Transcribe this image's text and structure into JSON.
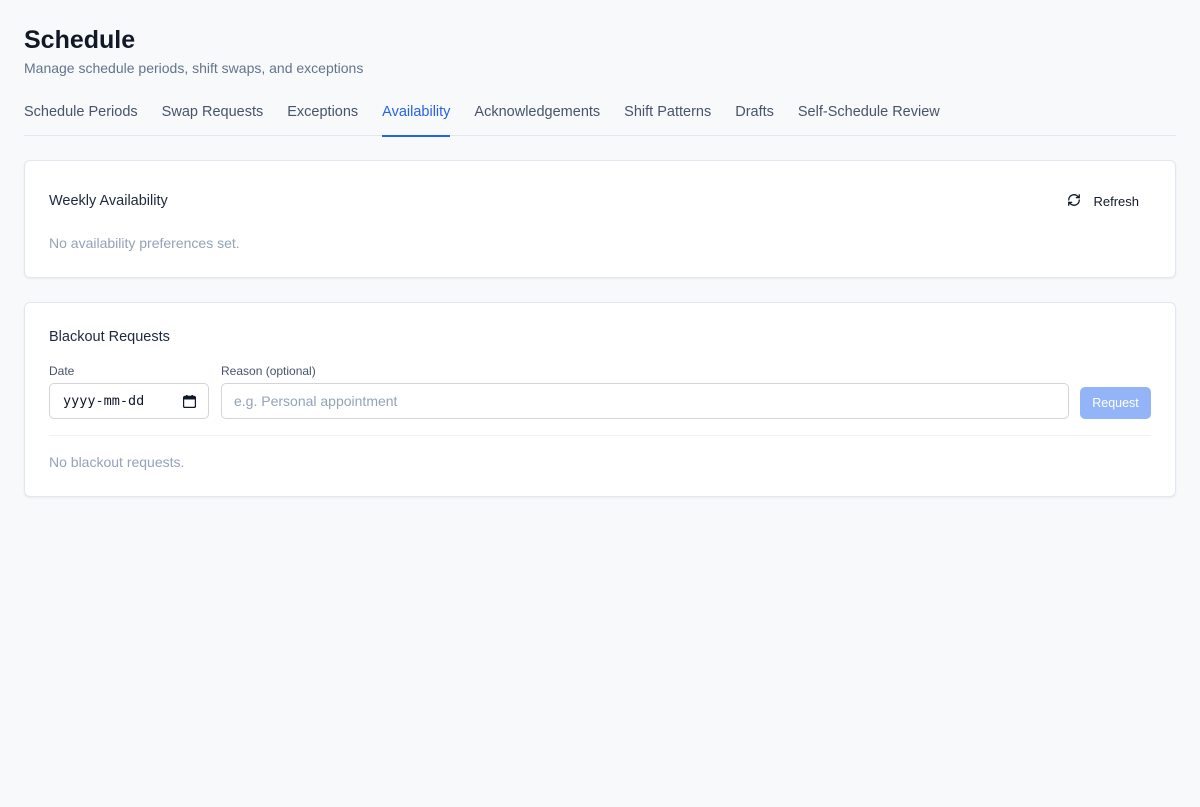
{
  "header": {
    "title": "Schedule",
    "subtitle": "Manage schedule periods, shift swaps, and exceptions"
  },
  "tabs": [
    {
      "label": "Schedule Periods",
      "active": false
    },
    {
      "label": "Swap Requests",
      "active": false
    },
    {
      "label": "Exceptions",
      "active": false
    },
    {
      "label": "Availability",
      "active": true
    },
    {
      "label": "Acknowledgements",
      "active": false
    },
    {
      "label": "Shift Patterns",
      "active": false
    },
    {
      "label": "Drafts",
      "active": false
    },
    {
      "label": "Self-Schedule Review",
      "active": false
    }
  ],
  "availability": {
    "title": "Weekly Availability",
    "refresh_label": "Refresh",
    "refresh_icon": "refresh-icon",
    "empty_text": "No availability preferences set."
  },
  "blackout": {
    "title": "Blackout Requests",
    "date_label": "Date",
    "date_placeholder": "yyyy-mm-dd",
    "date_icon": "calendar-icon",
    "reason_label": "Reason (optional)",
    "reason_placeholder": "e.g. Personal appointment",
    "reason_value": "",
    "request_label": "Request",
    "request_disabled": true,
    "empty_text": "No blackout requests."
  },
  "colors": {
    "accent": "#2563eb",
    "button_disabled": "#93b4f7",
    "background": "#f8f9fb",
    "muted_text": "#94a3b8"
  }
}
